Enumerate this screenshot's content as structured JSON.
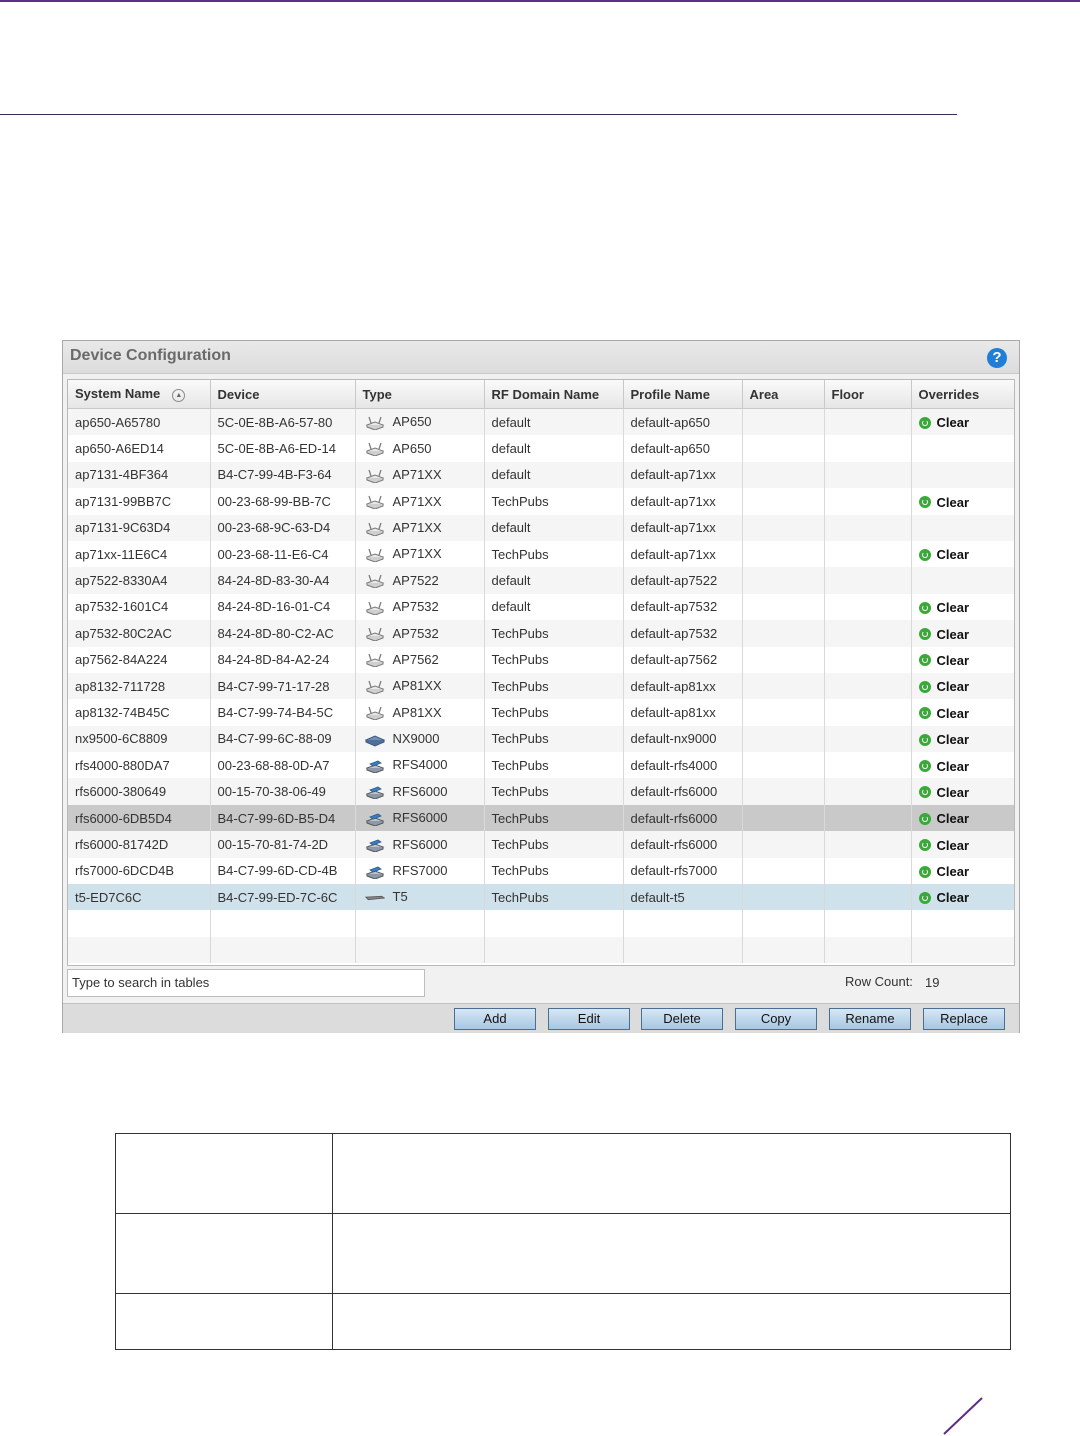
{
  "panel": {
    "title": "Device Configuration",
    "help": "?"
  },
  "columns": [
    "System Name",
    "Device",
    "Type",
    "RF Domain Name",
    "Profile Name",
    "Area",
    "Floor",
    "Overrides"
  ],
  "rows": [
    {
      "name": "ap650-A65780",
      "device": "5C-0E-8B-A6-57-80",
      "type": "AP650",
      "icon": "ap-icon",
      "rf": "default",
      "profile": "default-ap650",
      "area": "",
      "floor": "",
      "override": "Clear"
    },
    {
      "name": "ap650-A6ED14",
      "device": "5C-0E-8B-A6-ED-14",
      "type": "AP650",
      "icon": "ap-icon",
      "rf": "default",
      "profile": "default-ap650",
      "area": "",
      "floor": "",
      "override": ""
    },
    {
      "name": "ap7131-4BF364",
      "device": "B4-C7-99-4B-F3-64",
      "type": "AP71XX",
      "icon": "ap-icon",
      "rf": "default",
      "profile": "default-ap71xx",
      "area": "",
      "floor": "",
      "override": ""
    },
    {
      "name": "ap7131-99BB7C",
      "device": "00-23-68-99-BB-7C",
      "type": "AP71XX",
      "icon": "ap-icon",
      "rf": "TechPubs",
      "profile": "default-ap71xx",
      "area": "",
      "floor": "",
      "override": "Clear"
    },
    {
      "name": "ap7131-9C63D4",
      "device": "00-23-68-9C-63-D4",
      "type": "AP71XX",
      "icon": "ap-icon",
      "rf": "default",
      "profile": "default-ap71xx",
      "area": "",
      "floor": "",
      "override": ""
    },
    {
      "name": "ap71xx-11E6C4",
      "device": "00-23-68-11-E6-C4",
      "type": "AP71XX",
      "icon": "ap-icon",
      "rf": "TechPubs",
      "profile": "default-ap71xx",
      "area": "",
      "floor": "",
      "override": "Clear"
    },
    {
      "name": "ap7522-8330A4",
      "device": "84-24-8D-83-30-A4",
      "type": "AP7522",
      "icon": "ap-icon",
      "rf": "default",
      "profile": "default-ap7522",
      "area": "",
      "floor": "",
      "override": ""
    },
    {
      "name": "ap7532-1601C4",
      "device": "84-24-8D-16-01-C4",
      "type": "AP7532",
      "icon": "ap-icon",
      "rf": "default",
      "profile": "default-ap7532",
      "area": "",
      "floor": "",
      "override": "Clear"
    },
    {
      "name": "ap7532-80C2AC",
      "device": "84-24-8D-80-C2-AC",
      "type": "AP7532",
      "icon": "ap-icon",
      "rf": "TechPubs",
      "profile": "default-ap7532",
      "area": "",
      "floor": "",
      "override": "Clear"
    },
    {
      "name": "ap7562-84A224",
      "device": "84-24-8D-84-A2-24",
      "type": "AP7562",
      "icon": "ap-icon",
      "rf": "TechPubs",
      "profile": "default-ap7562",
      "area": "",
      "floor": "",
      "override": "Clear"
    },
    {
      "name": "ap8132-711728",
      "device": "B4-C7-99-71-17-28",
      "type": "AP81XX",
      "icon": "ap-icon",
      "rf": "TechPubs",
      "profile": "default-ap81xx",
      "area": "",
      "floor": "",
      "override": "Clear"
    },
    {
      "name": "ap8132-74B45C",
      "device": "B4-C7-99-74-B4-5C",
      "type": "AP81XX",
      "icon": "ap-icon",
      "rf": "TechPubs",
      "profile": "default-ap81xx",
      "area": "",
      "floor": "",
      "override": "Clear"
    },
    {
      "name": "nx9500-6C8809",
      "device": "B4-C7-99-6C-88-09",
      "type": "NX9000",
      "icon": "nx-icon",
      "rf": "TechPubs",
      "profile": "default-nx9000",
      "area": "",
      "floor": "",
      "override": "Clear"
    },
    {
      "name": "rfs4000-880DA7",
      "device": "00-23-68-88-0D-A7",
      "type": "RFS4000",
      "icon": "rfs-icon",
      "rf": "TechPubs",
      "profile": "default-rfs4000",
      "area": "",
      "floor": "",
      "override": "Clear"
    },
    {
      "name": "rfs6000-380649",
      "device": "00-15-70-38-06-49",
      "type": "RFS6000",
      "icon": "rfs-icon",
      "rf": "TechPubs",
      "profile": "default-rfs6000",
      "area": "",
      "floor": "",
      "override": "Clear"
    },
    {
      "name": "rfs6000-6DB5D4",
      "device": "B4-C7-99-6D-B5-D4",
      "type": "RFS6000",
      "icon": "rfs-icon",
      "rf": "TechPubs",
      "profile": "default-rfs6000",
      "area": "",
      "floor": "",
      "override": "Clear"
    },
    {
      "name": "rfs6000-81742D",
      "device": "00-15-70-81-74-2D",
      "type": "RFS6000",
      "icon": "rfs-icon",
      "rf": "TechPubs",
      "profile": "default-rfs6000",
      "area": "",
      "floor": "",
      "override": "Clear"
    },
    {
      "name": "rfs7000-6DCD4B",
      "device": "B4-C7-99-6D-CD-4B",
      "type": "RFS7000",
      "icon": "rfs-icon",
      "rf": "TechPubs",
      "profile": "default-rfs7000",
      "area": "",
      "floor": "",
      "override": "Clear"
    },
    {
      "name": "t5-ED7C6C",
      "device": "B4-C7-99-ED-7C-6C",
      "type": "T5",
      "icon": "t5-icon",
      "rf": "TechPubs",
      "profile": "default-t5",
      "area": "",
      "floor": "",
      "override": "Clear"
    }
  ],
  "search": {
    "placeholder": "Type to search in tables"
  },
  "row_count": {
    "label": "Row Count:",
    "value": "19"
  },
  "buttons": {
    "add": "Add",
    "edit": "Edit",
    "delete": "Delete",
    "copy": "Copy",
    "rename": "Rename",
    "replace": "Replace"
  },
  "colors": {
    "accent": "#5b2d86",
    "button_top": "#d6e7f5",
    "button_bottom": "#a7c7e3",
    "clear_icon": "#3aa93a",
    "selected_gray": "#c9c9c9",
    "selected_blue": "#cfe1ea"
  }
}
